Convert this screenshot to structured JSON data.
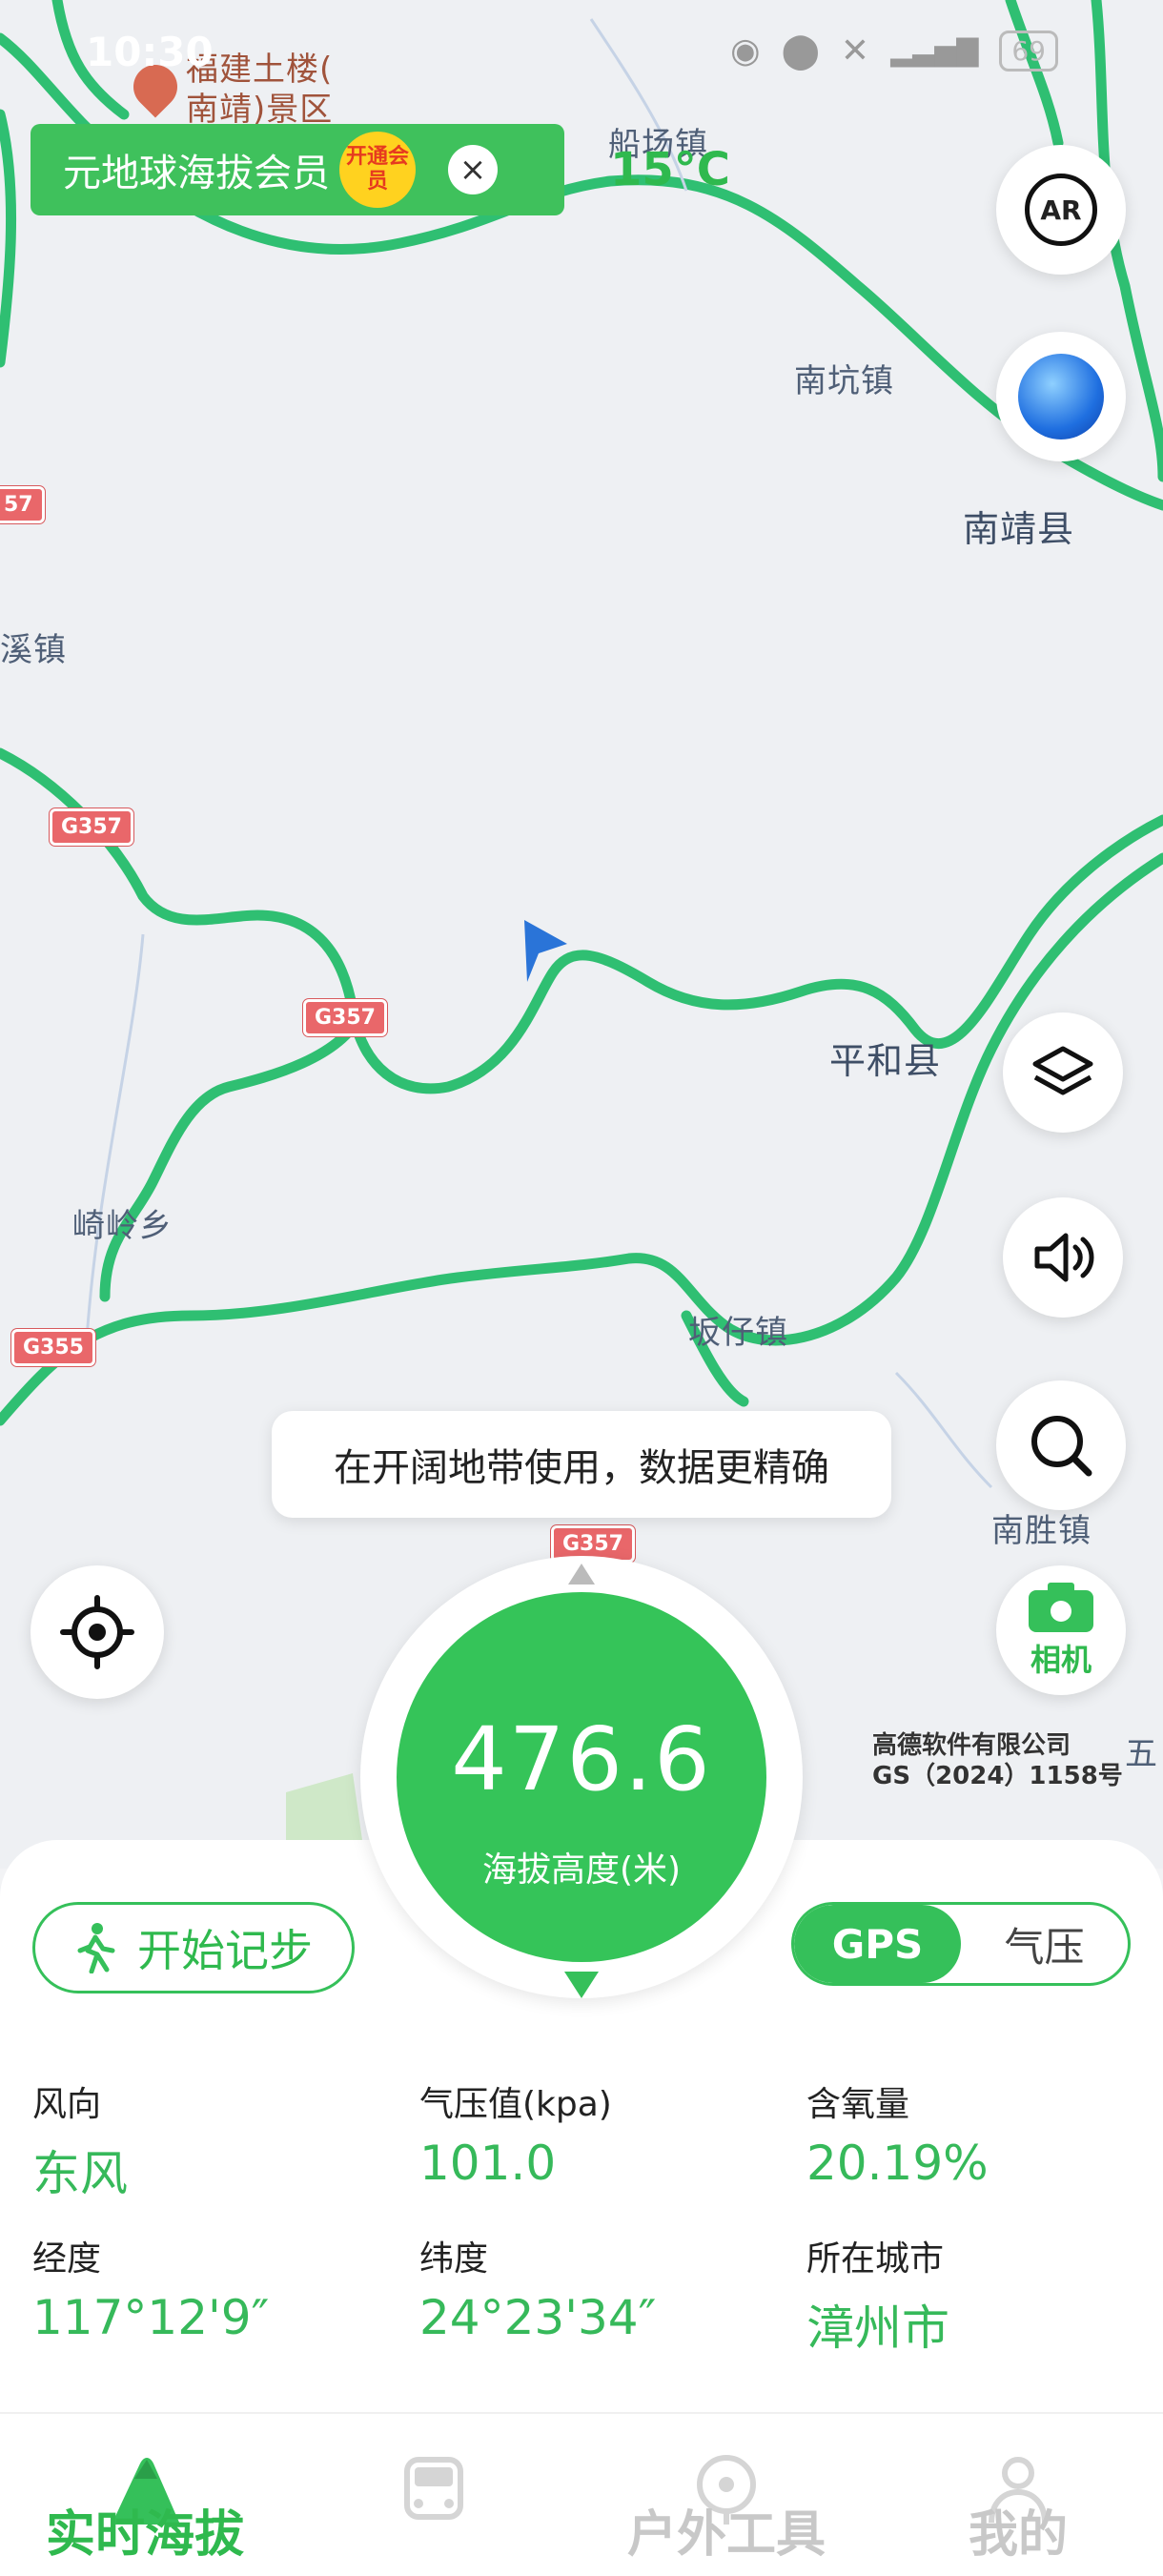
{
  "status_bar": {
    "time": "10:30",
    "battery": "69"
  },
  "promo": {
    "text": "元地球海拔会员",
    "badge": "开通会员",
    "close": "×"
  },
  "weather": {
    "temp": "15°C"
  },
  "map": {
    "places": [
      {
        "id": "fujian-tulou",
        "text": "福建土楼(\n南靖)景区"
      },
      {
        "id": "chuanchang",
        "text": "船场镇"
      },
      {
        "id": "nankeng",
        "text": "南坑镇"
      },
      {
        "id": "nanjing-county",
        "text": "南靖县"
      },
      {
        "id": "xizhen",
        "text": "溪镇"
      },
      {
        "id": "pinghe",
        "text": "平和县"
      },
      {
        "id": "qiling",
        "text": "崎岭乡"
      },
      {
        "id": "banzai",
        "text": "坂仔镇"
      },
      {
        "id": "nansheng",
        "text": "南胜镇"
      },
      {
        "id": "wu",
        "text": "五"
      }
    ],
    "shields": [
      "57",
      "G357",
      "G357",
      "G355",
      "G357"
    ],
    "tip": "在开阔地带使用，数据更精确",
    "copyright_line1": "高德软件有限公司",
    "copyright_line2": "GS（2024）1158号",
    "buttons": {
      "ar_label": "AR",
      "camera_label": "相机"
    }
  },
  "altitude": {
    "value": "476.6",
    "label": "海拔高度(米)"
  },
  "controls": {
    "step_button": "开始记步",
    "mode_gps": "GPS",
    "mode_pressure": "气压"
  },
  "stats": [
    {
      "label": "风向",
      "value": "东风"
    },
    {
      "label": "气压值(kpa)",
      "value": "101.0"
    },
    {
      "label": "含氧量",
      "value": "20.19%"
    },
    {
      "label": "经度",
      "value": "117°12'9″"
    },
    {
      "label": "纬度",
      "value": "24°23'34″"
    },
    {
      "label": "所在城市",
      "value": "漳州市"
    }
  ],
  "tabs": [
    {
      "label": "实时海拔",
      "active": true
    },
    {
      "label": "",
      "active": false
    },
    {
      "label": "户外工具",
      "active": false
    },
    {
      "label": "我的",
      "active": false
    }
  ],
  "colors": {
    "accent": "#35c05a",
    "road": "#2fbf72",
    "shield": "#e9676a"
  }
}
